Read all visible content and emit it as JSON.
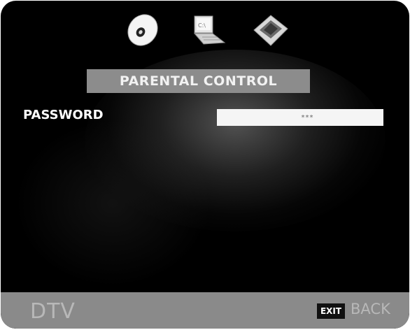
{
  "menu_icons": [
    "disc-icon",
    "laptop-icon",
    "chip-icon"
  ],
  "title": "PARENTAL CONTROL",
  "password": {
    "label": "PASSWORD",
    "value": "***"
  },
  "footer": {
    "source": "DTV",
    "exit_key": "EXIT",
    "back_label": "BACK"
  }
}
